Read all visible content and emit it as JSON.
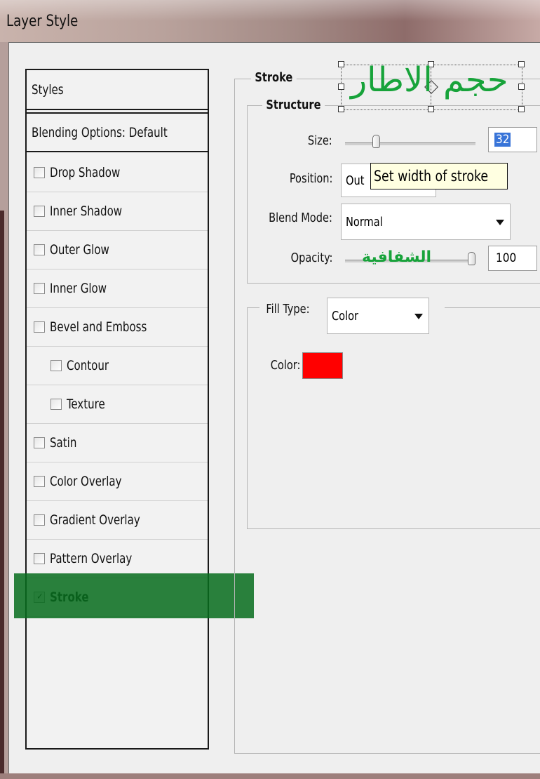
{
  "window": {
    "title": "Layer Style"
  },
  "styles": {
    "header": "Styles",
    "blending": "Blending Options: Default",
    "items": [
      {
        "label": "Drop Shadow",
        "checked": false,
        "indent": false
      },
      {
        "label": "Inner Shadow",
        "checked": false,
        "indent": false
      },
      {
        "label": "Outer Glow",
        "checked": false,
        "indent": false
      },
      {
        "label": "Inner Glow",
        "checked": false,
        "indent": false
      },
      {
        "label": "Bevel and Emboss",
        "checked": false,
        "indent": false
      },
      {
        "label": "Contour",
        "checked": false,
        "indent": true
      },
      {
        "label": "Texture",
        "checked": false,
        "indent": true
      },
      {
        "label": "Satin",
        "checked": false,
        "indent": false
      },
      {
        "label": "Color Overlay",
        "checked": false,
        "indent": false
      },
      {
        "label": "Gradient Overlay",
        "checked": false,
        "indent": false
      },
      {
        "label": "Pattern Overlay",
        "checked": false,
        "indent": false
      },
      {
        "label": "Stroke",
        "checked": true,
        "indent": false
      }
    ]
  },
  "stroke": {
    "legend": "Stroke",
    "structure": {
      "legend": "Structure",
      "size_label": "Size:",
      "size_value": "32",
      "size_level": 0.22,
      "position_label": "Position:",
      "position_value": "Out",
      "blend_label": "Blend Mode:",
      "blend_value": "Normal",
      "opacity_label": "Opacity:",
      "opacity_value": "100",
      "opacity_level": 1.0
    },
    "fill": {
      "legend": "Fill Type:",
      "type_value": "Color",
      "color_label": "Color:",
      "color": "#ff0000"
    }
  },
  "tooltip": "Set width of stroke",
  "annotations": {
    "size_arabic": "حجم الاطار",
    "opacity_arabic": "الشفافية",
    "color": "#17a33a"
  },
  "highlight_color": "#086e1e"
}
